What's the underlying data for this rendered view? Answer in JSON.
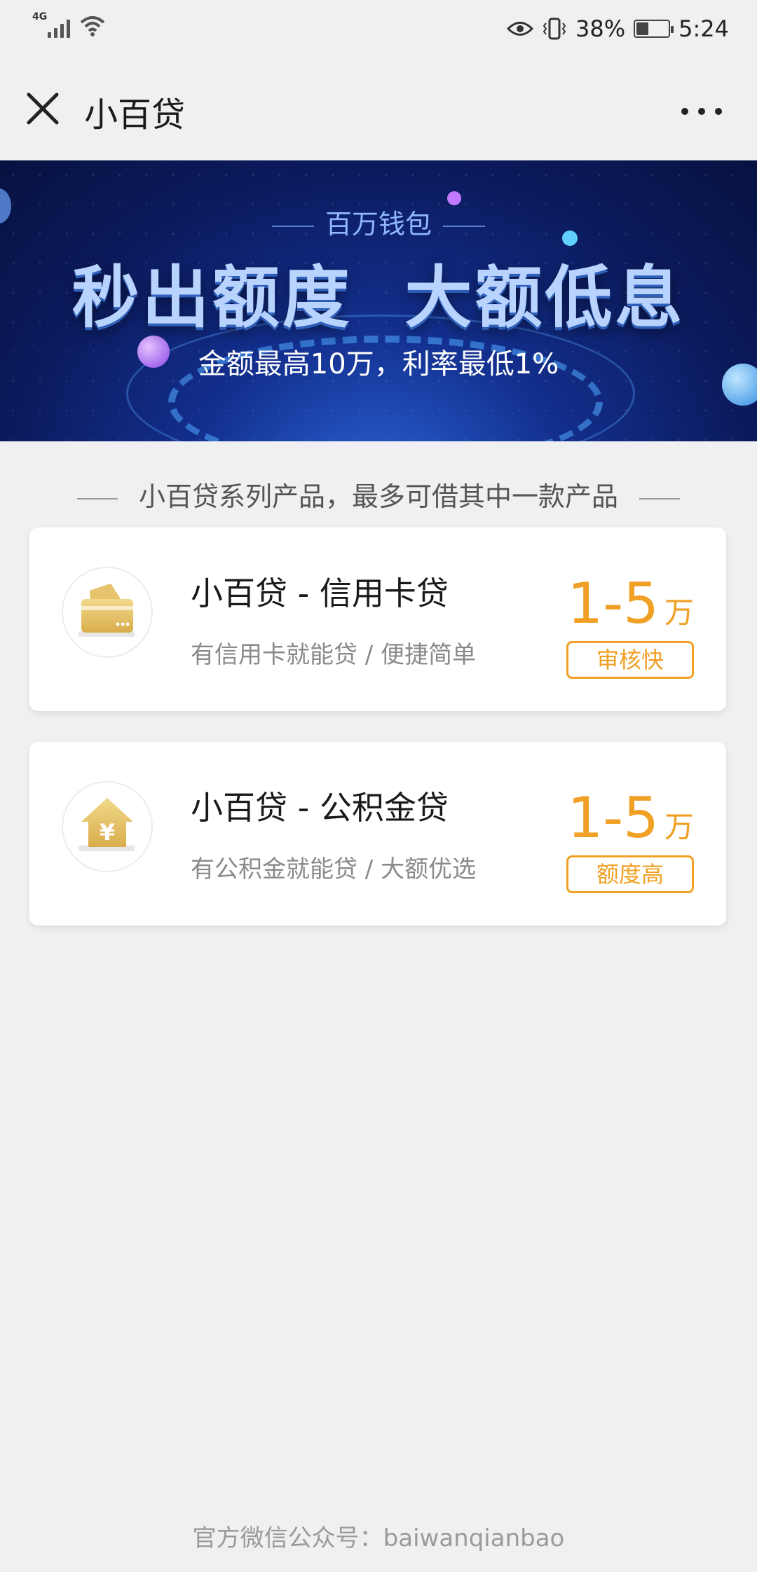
{
  "status_bar": {
    "network": "4G",
    "battery": "38%",
    "time": "5:24",
    "battery_level": 0.38
  },
  "nav": {
    "title": "小百贷"
  },
  "banner": {
    "subtitle": "百万钱包",
    "headline": "秒出额度  大额低息",
    "description": "金额最高10万，利率最低1%"
  },
  "section": {
    "heading": "小百贷系列产品，最多可借其中一款产品"
  },
  "products": [
    {
      "name": "小百贷 - 信用卡贷",
      "desc": "有信用卡就能贷 / 便捷简单",
      "amount": "1-5",
      "unit": "万",
      "tag": "审核快",
      "icon": "credit-card-icon"
    },
    {
      "name": "小百贷 - 公积金贷",
      "desc": "有公积金就能贷 / 大额优选",
      "amount": "1-5",
      "unit": "万",
      "tag": "额度高",
      "icon": "house-yuan-icon"
    }
  ],
  "footer": {
    "text": "官方微信公众号：baiwanqianbao"
  },
  "colors": {
    "accent": "#f0a024",
    "banner_bg": "#0b1a5c",
    "page_bg": "#f0f0f2"
  }
}
